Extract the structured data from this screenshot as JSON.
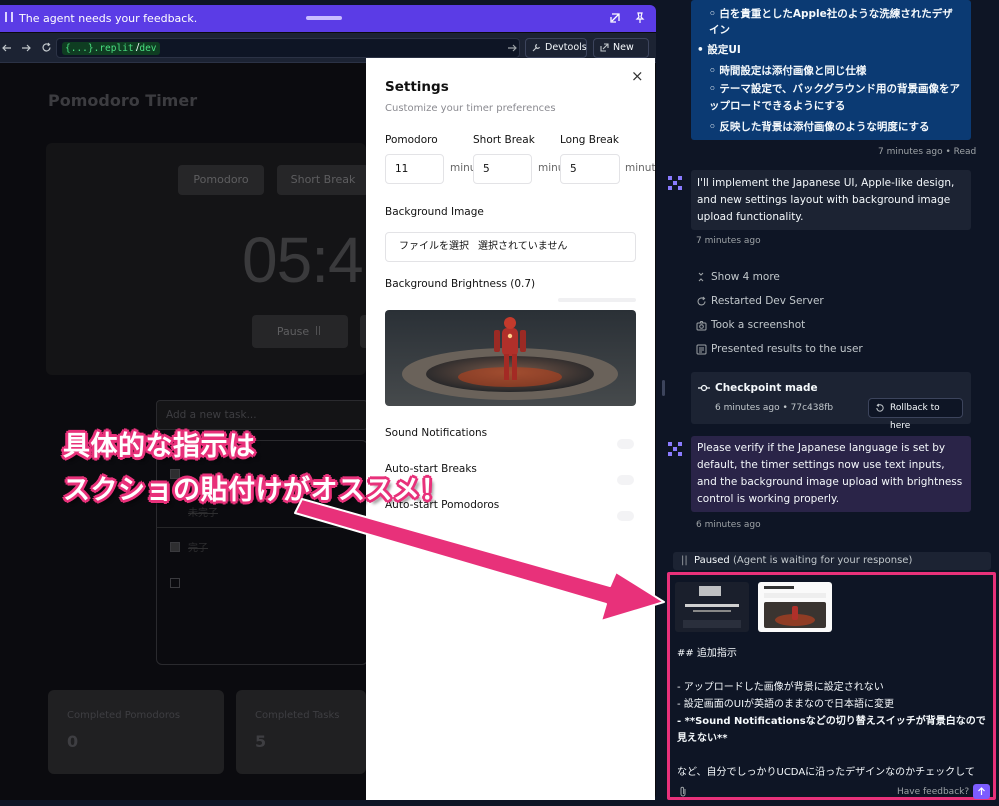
{
  "preview": {
    "banner": "The agent needs your feedback.",
    "address": {
      "domain": "{...}.replit.dev",
      "path": "/"
    },
    "devtools_label": "Devtools",
    "newtab_label": "New tab"
  },
  "app": {
    "title": "Pomodoro Timer",
    "modes": [
      "Pomodoro",
      "Short Break"
    ],
    "timer": "05:4",
    "pause_label": "Pause",
    "task_placeholder": "Add a new task...",
    "tasks": [
      "未完了",
      "完了"
    ],
    "stats": [
      {
        "label": "Completed Pomodoros",
        "value": "0"
      },
      {
        "label": "Completed Tasks",
        "value": "5"
      }
    ]
  },
  "settings": {
    "title": "Settings",
    "subtitle": "Customize your timer preferences",
    "close": "×",
    "durations": [
      {
        "label": "Pomodoro",
        "value": "11",
        "unit": "minu"
      },
      {
        "label": "Short Break",
        "value": "5",
        "unit": "minu"
      },
      {
        "label": "Long Break",
        "value": "5",
        "unit": "minut"
      }
    ],
    "background_image_label": "Background Image",
    "file_button": "ファイルを選択",
    "file_status": "選択されていません",
    "brightness_label": "Background Brightness (0.7)",
    "brightness": 0.7,
    "toggles": [
      "Sound Notifications",
      "Auto-start Breaks",
      "Auto-start Pomodoros"
    ]
  },
  "annotation": {
    "line1": "具体的な指示は",
    "line2": "スクショの貼付けがオススメ！"
  },
  "chat": {
    "user_msg1": {
      "items": [
        {
          "level": 2,
          "text": "白を貴重としたApple社のような洗練されたデザイン"
        },
        {
          "level": 1,
          "text": "設定UI"
        },
        {
          "level": 2,
          "text": "時間設定は添付画像と同じ仕様"
        },
        {
          "level": 2,
          "text": "テーマ設定で、バックグラウンド用の背景画像をアップロードできるようにする"
        },
        {
          "level": 2,
          "text": "反映した背景は添付画像のような明度にする"
        }
      ],
      "meta": "7 minutes ago • Read"
    },
    "agent_msg1": {
      "text": "I'll implement the Japanese UI, Apple-like design, and new settings layout with background image upload functionality.",
      "time": "7 minutes ago"
    },
    "actions": [
      {
        "icon": "chevron-icon",
        "text": "Show 4 more"
      },
      {
        "icon": "restart-icon",
        "text": "Restarted Dev Server"
      },
      {
        "icon": "camera-icon",
        "text": "Took a screenshot"
      },
      {
        "icon": "present-icon",
        "text": "Presented results to the user"
      }
    ],
    "checkpoint": {
      "title": "Checkpoint made",
      "meta": "6 minutes ago • 77c438fb",
      "rollback": "Rollback to here"
    },
    "agent_msg2": {
      "text": "Please verify if the Japanese language is set by default, the timer settings now use text inputs, and the background image upload with brightness control is working properly.",
      "time": "6 minutes ago"
    },
    "paused": {
      "label": "Paused",
      "detail": "(Agent is waiting for your response)"
    },
    "composer": {
      "lines": [
        "## 追加指示",
        "",
        "- アップロードした画像が背景に設定されない",
        "- 設定画面のUIが英語のままなので日本語に変更",
        "- **Sound Notificationsなどの切り替えスイッチが背景白なので見えない**",
        "",
        "など、自分でしっかりUCDAに沿ったデザインなのかチェックして"
      ],
      "feedback": "Have feedback?"
    }
  },
  "colors": {
    "banner": "#5b3ce6",
    "annotation": "#e8317a",
    "user_bubble": "#0b3a73",
    "agent_bubble": "#1c2333",
    "domain_green": "#4ade80"
  }
}
